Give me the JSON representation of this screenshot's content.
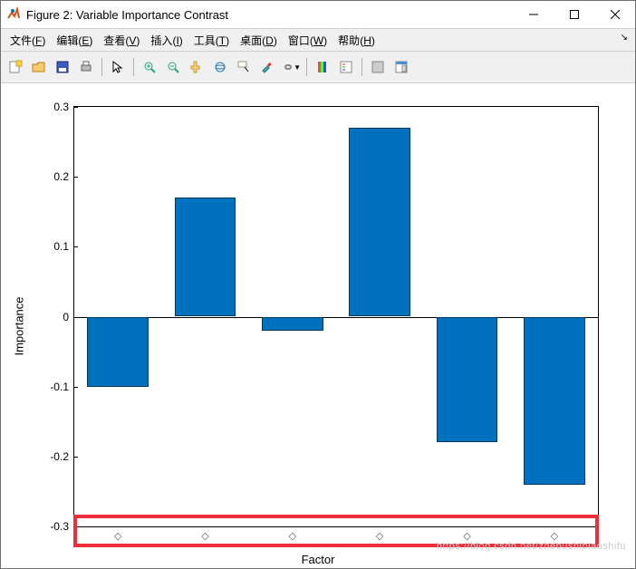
{
  "window": {
    "title": "Figure 2: Variable Importance Contrast"
  },
  "menu": {
    "file": {
      "label": "文件",
      "hot": "F"
    },
    "edit": {
      "label": "编辑",
      "hot": "E"
    },
    "view": {
      "label": "查看",
      "hot": "V"
    },
    "insert": {
      "label": "插入",
      "hot": "I"
    },
    "tools": {
      "label": "工具",
      "hot": "T"
    },
    "desktop": {
      "label": "桌面",
      "hot": "D"
    },
    "windowm": {
      "label": "窗口",
      "hot": "W"
    },
    "help": {
      "label": "帮助",
      "hot": "H"
    }
  },
  "toolbar": {
    "new": "new-figure",
    "open": "open",
    "save": "save",
    "print": "print",
    "pointer": "pointer",
    "zoomin": "zoom-in",
    "zoomout": "zoom-out",
    "pan": "pan",
    "rotate": "rotate-3d",
    "datacursor": "data-cursor",
    "brush": "brush",
    "link": "link-plots",
    "colorbar": "insert-colorbar",
    "legend": "insert-legend",
    "hide": "hide-tools",
    "dock": "dock-figure"
  },
  "chart_data": {
    "type": "bar",
    "categories": [
      "◇",
      "◇",
      "◇",
      "◇",
      "◇",
      "◇"
    ],
    "values": [
      -0.1,
      0.17,
      -0.02,
      0.27,
      -0.18,
      -0.24
    ],
    "xlabel": "Factor",
    "ylabel": "Importance",
    "ylim": [
      -0.3,
      0.3
    ],
    "yticks": [
      -0.3,
      -0.2,
      -0.1,
      0,
      0.1,
      0.2,
      0.3
    ],
    "ytick_labels": [
      "-0.3",
      "-0.2",
      "-0.1",
      "0",
      "0.1",
      "0.2",
      "0.3"
    ]
  },
  "watermark": "https://blog.csdn.net/zhebushibiaoshifu"
}
